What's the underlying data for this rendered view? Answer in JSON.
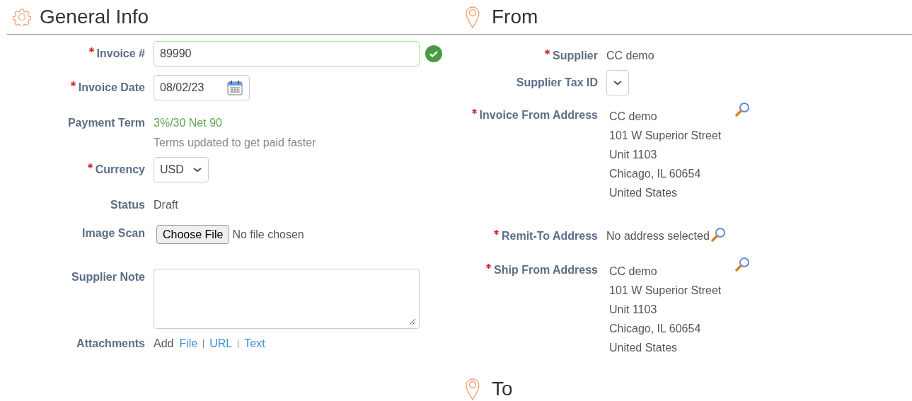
{
  "general_info": {
    "title": "General Info",
    "fields": [
      {
        "kind": "text_input",
        "label": "Invoice #",
        "required": true,
        "value": "89990",
        "valid": true
      },
      {
        "kind": "date_input",
        "label": "Invoice Date",
        "required": true,
        "value": "08/02/23"
      },
      {
        "kind": "term",
        "label": "Payment Term",
        "required": false,
        "value": "3%/30 Net 90",
        "note": "Terms updated to get paid faster"
      },
      {
        "kind": "select",
        "label": "Currency",
        "required": true,
        "value": "USD"
      },
      {
        "kind": "text",
        "label": "Status",
        "required": false,
        "value": "Draft"
      },
      {
        "kind": "file",
        "label": "Image Scan",
        "required": false,
        "button": "Choose File",
        "status": "No file chosen"
      },
      {
        "kind": "textarea",
        "label": "Supplier Note",
        "required": false
      },
      {
        "kind": "attachments",
        "label": "Attachments",
        "required": false,
        "prefix": "Add",
        "links": [
          "File",
          "URL",
          "Text"
        ]
      }
    ]
  },
  "from": {
    "title": "From",
    "fields": [
      {
        "kind": "text",
        "label": "Supplier",
        "required": true,
        "value": "CC demo"
      },
      {
        "kind": "select",
        "label": "Supplier Tax ID",
        "required": false
      },
      {
        "kind": "address",
        "label": "Invoice From Address",
        "required": true,
        "lines": [
          "CC demo",
          "101 W Superior Street",
          "Unit 1103",
          "Chicago, IL 60654",
          "United States"
        ]
      },
      {
        "kind": "empty_address",
        "label": "Remit-To Address",
        "required": true,
        "value": "No address selected"
      },
      {
        "kind": "address",
        "label": "Ship From Address",
        "required": true,
        "lines": [
          "CC demo",
          "101 W Superior Street",
          "Unit 1103",
          "Chicago, IL 60654",
          "United States"
        ]
      }
    ]
  },
  "to": {
    "title": "To"
  }
}
